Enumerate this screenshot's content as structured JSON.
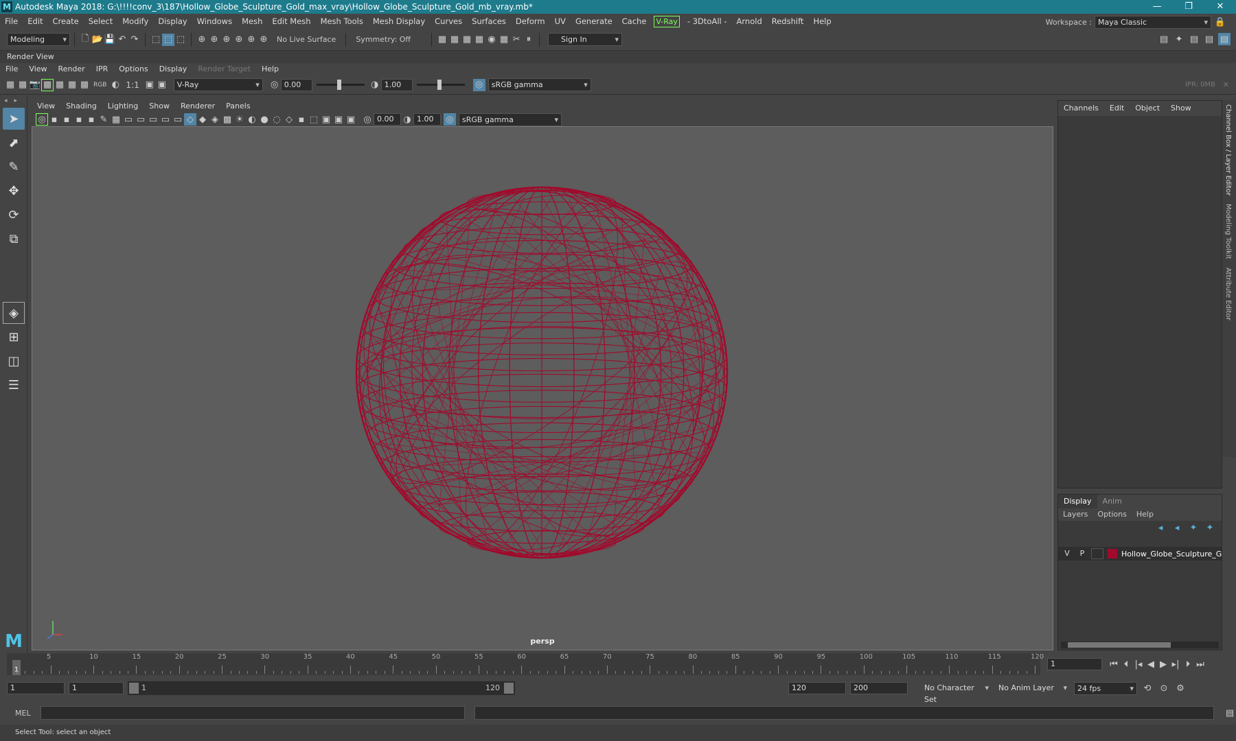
{
  "window": {
    "title": "Autodesk Maya 2018: G:\\!!!!conv_3\\187\\Hollow_Globe_Sculpture_Gold_max_vray\\Hollow_Globe_Sculpture_Gold_mb_vray.mb*",
    "logo": "M"
  },
  "main_menu": [
    "File",
    "Edit",
    "Create",
    "Select",
    "Modify",
    "Display",
    "Windows",
    "Mesh",
    "Edit Mesh",
    "Mesh Tools",
    "Mesh Display",
    "Curves",
    "Surfaces",
    "Deform",
    "UV",
    "Generate",
    "Cache",
    "V-Ray",
    "- 3DtoAll -",
    "Arnold",
    "Redshift",
    "Help"
  ],
  "workspace": {
    "label": "Workspace :",
    "value": "Maya Classic"
  },
  "status_line": {
    "mode": "Modeling",
    "live_surface": "No Live Surface",
    "symmetry": "Symmetry: Off",
    "sign_in": "Sign In"
  },
  "render_view": {
    "title": "Render View",
    "menu": [
      "File",
      "View",
      "Render",
      "IPR",
      "Options",
      "Display",
      "Render Target",
      "Help"
    ],
    "disabled_menu": "Render Target",
    "ratio": "1:1",
    "renderer": "V-Ray",
    "exposure": "0.00",
    "gamma": "1.00",
    "color_space": "sRGB gamma",
    "ipr_status": "IPR: 0MB",
    "rgb_label": "RGB"
  },
  "viewport": {
    "menu": [
      "View",
      "Shading",
      "Lighting",
      "Show",
      "Renderer",
      "Panels"
    ],
    "exposure": "0.00",
    "gamma": "1.00",
    "color_space": "sRGB gamma",
    "camera": "persp",
    "wire_color": "#a10a2c"
  },
  "channel_box": {
    "menu": [
      "Channels",
      "Edit",
      "Object",
      "Show"
    ]
  },
  "layer_editor": {
    "tabs": [
      "Display",
      "Anim"
    ],
    "menu": [
      "Layers",
      "Options",
      "Help"
    ],
    "layer": {
      "v": "V",
      "p": "P",
      "name": "Hollow_Globe_Sculpture_Gold",
      "color": "#a10a2c"
    }
  },
  "side_tabs": [
    "Channel Box / Layer Editor",
    "Modeling Toolkit",
    "Attribute Editor"
  ],
  "timeline": {
    "ticks": [
      5,
      10,
      15,
      20,
      25,
      30,
      35,
      40,
      45,
      50,
      55,
      60,
      65,
      70,
      75,
      80,
      85,
      90,
      95,
      100,
      105,
      110,
      115,
      120
    ],
    "start_label": "1",
    "current_frame": "1"
  },
  "range": {
    "start": "1",
    "playback_start": "1",
    "range_start": "1",
    "range_end": "120",
    "playback_end": "120",
    "end": "200",
    "character_set": "No Character Set",
    "anim_layer": "No Anim Layer",
    "fps": "24 fps"
  },
  "command_line": {
    "label": "MEL"
  },
  "help_line": "Select Tool: select an object"
}
